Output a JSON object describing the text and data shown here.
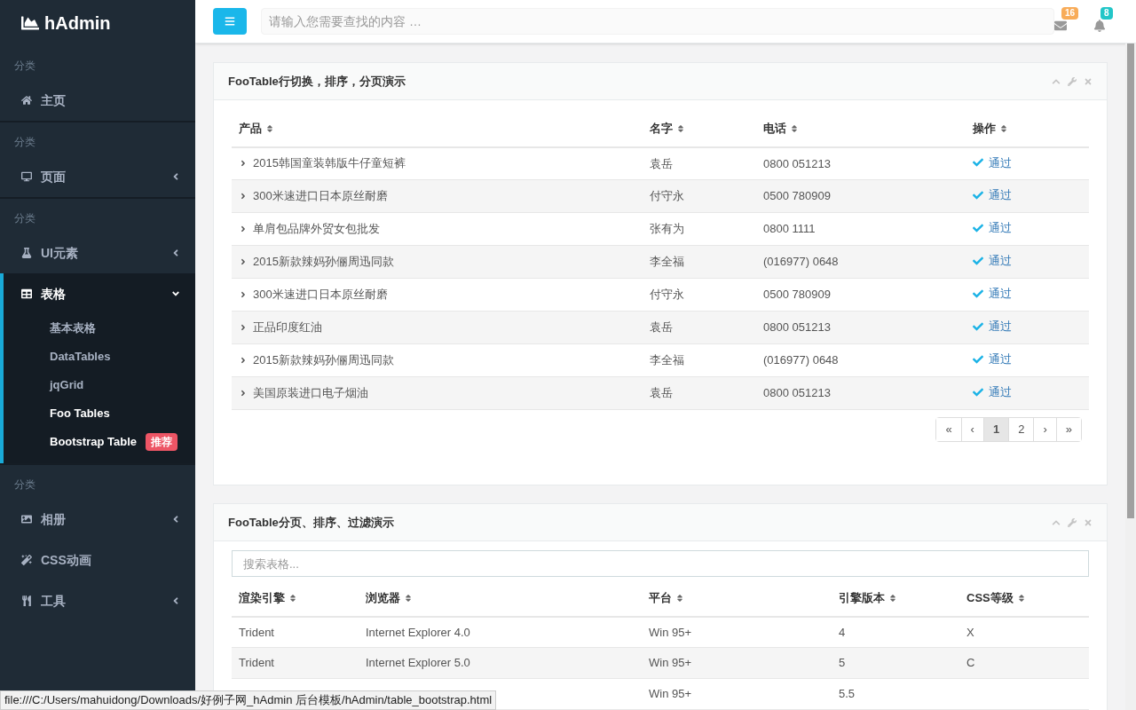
{
  "sidebar": {
    "logo": "hAdmin",
    "groups": [
      {
        "heading": "分类",
        "items": [
          {
            "label": "主页",
            "kind": "link"
          }
        ]
      },
      {
        "heading": "分类",
        "items": [
          {
            "label": "页面",
            "kind": "submenu",
            "expanded": false
          }
        ]
      },
      {
        "heading": "分类",
        "items": [
          {
            "label": "UI元素",
            "kind": "submenu",
            "expanded": false
          },
          {
            "label": "表格",
            "kind": "submenu",
            "expanded": true,
            "children": [
              {
                "label": "基本表格",
                "selected": false
              },
              {
                "label": "DataTables",
                "selected": false
              },
              {
                "label": "jqGrid",
                "selected": false
              },
              {
                "label": "Foo Tables",
                "selected": true
              },
              {
                "label": "Bootstrap Table",
                "selected": true,
                "badge": "推荐"
              }
            ]
          }
        ]
      },
      {
        "heading": "分类",
        "items": [
          {
            "label": "相册",
            "kind": "submenu",
            "expanded": false
          },
          {
            "label": "CSS动画",
            "kind": "link"
          },
          {
            "label": "工具",
            "kind": "submenu",
            "expanded": false
          }
        ]
      }
    ]
  },
  "topbar": {
    "search": {
      "placeholder": "请输入您需要查找的内容 …"
    },
    "notifications": [
      {
        "count": "16",
        "color": "#f8ac59"
      },
      {
        "count": "8",
        "color": "#23c6c8"
      }
    ]
  },
  "panels": [
    {
      "title": "FooTable行切换，排序，分页演示",
      "table": {
        "columns": [
          "产品",
          "名字",
          "电话",
          "操作"
        ],
        "rows": [
          [
            "2015韩国童装韩版牛仔童短裤",
            "袁岳",
            "0800 051213",
            "通过"
          ],
          [
            "300米速进口日本原丝耐磨",
            "付守永",
            "0500 780909",
            "通过"
          ],
          [
            "单肩包品牌外贸女包批发",
            "张有为",
            "0800 1111",
            "通过"
          ],
          [
            "2015新款辣妈孙俪周迅同款",
            "李全福",
            "(016977) 0648",
            "通过"
          ],
          [
            "300米速进口日本原丝耐磨",
            "付守永",
            "0500 780909",
            "通过"
          ],
          [
            "正品印度红油",
            "袁岳",
            "0800 051213",
            "通过"
          ],
          [
            "2015新款辣妈孙俪周迅同款",
            "李全福",
            "(016977) 0648",
            "通过"
          ],
          [
            "美国原装进口电子烟油",
            "袁岳",
            "0800 051213",
            "通过"
          ]
        ]
      },
      "pagination": [
        {
          "label": "«",
          "selected": false
        },
        {
          "label": "‹",
          "selected": false
        },
        {
          "label": "1",
          "selected": true
        },
        {
          "label": "2",
          "selected": false
        },
        {
          "label": "›",
          "selected": false
        },
        {
          "label": "»",
          "selected": false
        }
      ]
    },
    {
      "title": "FooTable分页、排序、过滤演示",
      "filter": {
        "placeholder": "搜索表格..."
      },
      "table": {
        "columns": [
          "渲染引擎",
          "浏览器",
          "平台",
          "引擎版本",
          "CSS等级"
        ],
        "rows": [
          [
            "Trident",
            "Internet Explorer 4.0",
            "Win 95+",
            "4",
            "X"
          ],
          [
            "Trident",
            "Internet Explorer 5.0",
            "Win 95+",
            "5",
            "C"
          ],
          [
            null,
            null,
            "Win 95+",
            "5.5",
            null
          ]
        ]
      }
    }
  ],
  "status_bar": "file:///C:/Users/mahuidong/Downloads/好例子网_hAdmin 后台模板/hAdmin/table_bootstrap.html"
}
